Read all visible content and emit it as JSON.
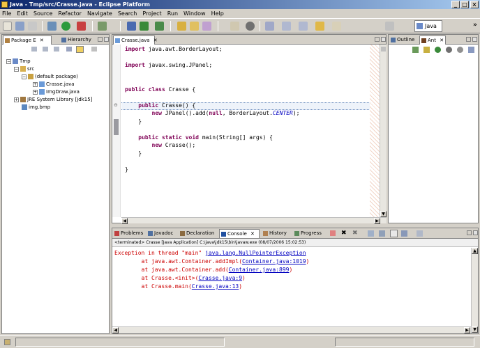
{
  "window": {
    "title": "Java - Tmp/src/Crasse.java - Eclipse Platform"
  },
  "menu": [
    "File",
    "Edit",
    "Source",
    "Refactor",
    "Navigate",
    "Search",
    "Project",
    "Run",
    "Window",
    "Help"
  ],
  "perspective": {
    "label": "Java"
  },
  "left_panel": {
    "tabs": [
      {
        "label": "Package E"
      },
      {
        "label": "Hierarchy"
      }
    ],
    "tree": [
      {
        "label": "Tmp",
        "indent": 0,
        "expander": "-",
        "icon": "project"
      },
      {
        "label": "src",
        "indent": 1,
        "expander": "-",
        "icon": "source-folder"
      },
      {
        "label": "(default package)",
        "indent": 2,
        "expander": "-",
        "icon": "package"
      },
      {
        "label": "Crasse.java",
        "indent": 3,
        "expander": "+",
        "icon": "java-file"
      },
      {
        "label": "ImgDraw.java",
        "indent": 3,
        "expander": "+",
        "icon": "java-file"
      },
      {
        "label": "JRE System Library [jdk15]",
        "indent": 1,
        "expander": "+",
        "icon": "library"
      },
      {
        "label": "img.bmp",
        "indent": 1,
        "expander": "",
        "icon": "image-file"
      }
    ]
  },
  "editor": {
    "tab_label": "Crasse.java",
    "lines": [
      [
        {
          "t": "import",
          "c": "kw"
        },
        {
          "t": " java.awt.BorderLayout;"
        }
      ],
      [],
      [
        {
          "t": "import",
          "c": "kw"
        },
        {
          "t": " javax.swing.JPanel;"
        }
      ],
      [],
      [],
      [
        {
          "t": "public class",
          "c": "kw"
        },
        {
          "t": " Crasse {"
        }
      ],
      [],
      [
        {
          "t": "    "
        },
        {
          "t": "public",
          "c": "kw"
        },
        {
          "t": " Crasse() {"
        }
      ],
      [
        {
          "t": "        "
        },
        {
          "t": "new",
          "c": "kw"
        },
        {
          "t": " JPanel().add("
        },
        {
          "t": "null",
          "c": "kw"
        },
        {
          "t": ", BorderLayout."
        },
        {
          "t": "CENTER",
          "c": "const"
        },
        {
          "t": ");"
        }
      ],
      [
        {
          "t": "    }"
        }
      ],
      [],
      [
        {
          "t": "    "
        },
        {
          "t": "public static void",
          "c": "kw"
        },
        {
          "t": " main(String[] args) {"
        }
      ],
      [
        {
          "t": "        "
        },
        {
          "t": "new",
          "c": "kw"
        },
        {
          "t": " Crasse();"
        }
      ],
      [
        {
          "t": "    }"
        }
      ],
      [],
      [
        {
          "t": "}"
        }
      ]
    ]
  },
  "right_panel": {
    "tabs": [
      {
        "label": "Outline"
      },
      {
        "label": "Ant"
      }
    ]
  },
  "bottom_panel": {
    "tabs": [
      {
        "label": "Problems"
      },
      {
        "label": "Javadoc"
      },
      {
        "label": "Declaration"
      },
      {
        "label": "Console"
      },
      {
        "label": "History"
      },
      {
        "label": "Progress"
      }
    ],
    "console_header": "<terminated> Crasse [Java Application] C:\\java\\jdk15\\bin\\javaw.exe (08/07/2006 15:02:53)",
    "console_lines": [
      [
        {
          "t": "Exception in thread \"main\" ",
          "c": "err"
        },
        {
          "t": "java.lang.NullPointerException",
          "c": "link"
        }
      ],
      [
        {
          "t": "        at java.awt.Container.addImpl(",
          "c": "err"
        },
        {
          "t": "Container.java:1019",
          "c": "link"
        },
        {
          "t": ")",
          "c": "err"
        }
      ],
      [
        {
          "t": "        at java.awt.Container.add(",
          "c": "err"
        },
        {
          "t": "Container.java:899",
          "c": "link"
        },
        {
          "t": ")",
          "c": "err"
        }
      ],
      [
        {
          "t": "        at Crasse.<init>(",
          "c": "err"
        },
        {
          "t": "Crasse.java:9",
          "c": "link"
        },
        {
          "t": ")",
          "c": "err"
        }
      ],
      [
        {
          "t": "        at Crasse.main(",
          "c": "err"
        },
        {
          "t": "Crasse.java:13",
          "c": "link"
        },
        {
          "t": ")",
          "c": "err"
        }
      ]
    ]
  }
}
